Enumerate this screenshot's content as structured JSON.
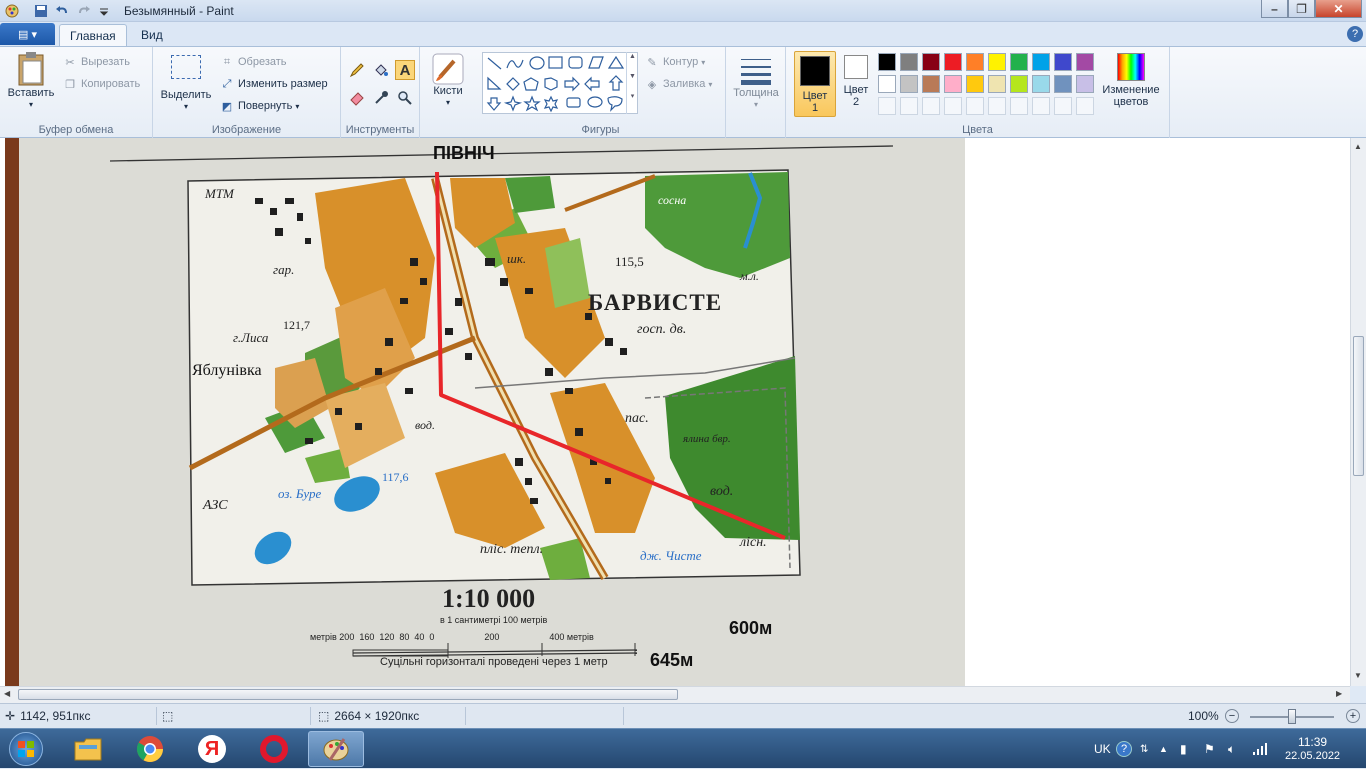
{
  "window": {
    "title": "Безымянный - Paint"
  },
  "tabs": {
    "file": "▤ ▾",
    "home": "Главная",
    "view": "Вид"
  },
  "clipboard": {
    "paste": "Вставить",
    "cut": "Вырезать",
    "copy": "Копировать",
    "group": "Буфер обмена"
  },
  "image": {
    "select": "Выделить",
    "crop": "Обрезать",
    "resize": "Изменить размер",
    "rotate": "Повернуть",
    "group": "Изображение"
  },
  "tools": {
    "group": "Инструменты",
    "brushes": "Кисти"
  },
  "shapes": {
    "outline": "Контур",
    "fill": "Заливка",
    "group": "Фигуры"
  },
  "size": {
    "label": "Толщина"
  },
  "colors": {
    "color1": "Цвет 1",
    "color2": "Цвет 2",
    "edit": "Изменение цветов",
    "group": "Цвета",
    "palette_row1": [
      "#000000",
      "#7f7f7f",
      "#880015",
      "#ed1c24",
      "#ff7f27",
      "#fff200",
      "#22b14c",
      "#00a2e8",
      "#3f48cc",
      "#a349a4"
    ],
    "palette_row2": [
      "#ffffff",
      "#c3c3c3",
      "#b97a57",
      "#ffaec9",
      "#ffc90e",
      "#efe4b0",
      "#b5e61d",
      "#99d9ea",
      "#7092be",
      "#c8bfe7"
    ]
  },
  "canvas": {
    "north_label": "ПІВНІЧ",
    "village": "БАРВИСТЕ",
    "village2": "Яблунівка",
    "scale": "1:10 000",
    "scale_sub": "в 1 сантиметрі 100 метрів",
    "scale_ticks": "метрів 200  160  120  80  40  0                    200                    400 метрів",
    "contours": "Суцільні горизонталі проведені через 1 метр",
    "dist1": "600м",
    "dist2": "645м",
    "map_labels": {
      "mtm": "МТМ",
      "azs": "АЗС",
      "gar": "гар.",
      "lysa": "г.Лиса",
      "h1217": "121,7",
      "sosna": "сосна",
      "ml": "м.л.",
      "gosp": "госп. дв.",
      "pas": "пас.",
      "vod1": "вод.",
      "vod2": "вод.",
      "burye": "оз. Буре",
      "chyste": "дж. Чисте",
      "lisn": "лісн.",
      "plys": "пліс. тепл.",
      "yalyna": "ялина бвр.",
      "h1155": "115,5",
      "h1176": "117,6",
      "shk": "шк."
    }
  },
  "status": {
    "cursor": "1142, 951пкс",
    "size": "2664 × 1920пкс",
    "zoom": "100%"
  },
  "taskbar": {
    "lang": "UK",
    "time": "11:39",
    "date": "22.05.2022"
  }
}
